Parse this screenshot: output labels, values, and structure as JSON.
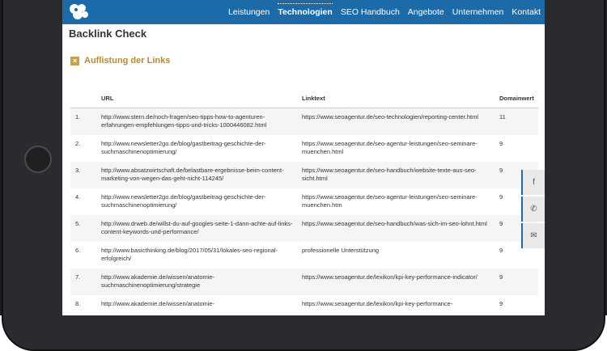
{
  "nav": {
    "items": [
      {
        "label": "Leistungen",
        "active": false
      },
      {
        "label": "Technologien",
        "active": true
      },
      {
        "label": "SEO Handbuch",
        "active": false
      },
      {
        "label": "Angebote",
        "active": false
      },
      {
        "label": "Unternehmen",
        "active": false
      },
      {
        "label": "Kontakt",
        "active": false
      }
    ]
  },
  "page": {
    "title": "Backlink Check",
    "accordion_label": "Auflistung der Links",
    "accordion_icon": "x-icon"
  },
  "table": {
    "headers": [
      "",
      "URL",
      "Linktext",
      "Domainwert"
    ],
    "rows": [
      {
        "num": "1.",
        "url": "http://www.stern.de/noch-fragen/seo-tipps-how-to-agenturen-erfahrungen-empfehlungen-tipps-und-tricks-1000446082.html",
        "linktext": "https://www.seoagentur.de/seo-technologien/reporting-center.html",
        "value": "11"
      },
      {
        "num": "2.",
        "url": "http://www.newsletter2go.de/blog/gastbeitrag-geschichte-der-suchmaschinenoptimierung/",
        "linktext": "https://www.seoagentur.de/seo-agentur-leistungen/seo-seminare-muenchen.html",
        "value": "9"
      },
      {
        "num": "3.",
        "url": "http://www.absatzwirtschaft.de/belastbare-ergebnisse-beim-content-marketing-von-wegen-das-geht-nicht-114245/",
        "linktext": "https://www.seoagentur.de/seo-handbuch/website-texte-aus-seo-sicht.html",
        "value": "9"
      },
      {
        "num": "4.",
        "url": "http://www.newsletter2go.de/blog/gastbeitrag-geschichte-der-suchmaschinenoptimierung/",
        "linktext": "https://www.seoagentur.de/seo-agentur-leistungen/seo-seminare-muenchen.htm",
        "value": "9"
      },
      {
        "num": "5.",
        "url": "http://www.drweb.de/willst-du-auf-googles-seite-1-dann-achte-auf-links-content-keywords-und-performance/",
        "linktext": "https://www.seoagentur.de/seo-handbuch/was-sich-im-seo-lohnt.html",
        "value": "9"
      },
      {
        "num": "6.",
        "url": "http://www.basicthinking.de/blog/2017/05/31/lokales-seo-regional-erfolgreich/",
        "linktext": "professionelle Unterstützung",
        "value": "9"
      },
      {
        "num": "7.",
        "url": "http://www.akademie.de/wissen/anatomie-suchmaschinenoptimierung/strategie",
        "linktext": "https://www.seoagentur.de/lexikon/kpi-key-performance-indicator/",
        "value": "9"
      },
      {
        "num": "8.",
        "url": "http://www.akademie.de/wissen/anatomie-",
        "linktext": "https://www.seoagentur.de/lexikon/kpi-key-performance-",
        "value": "9"
      }
    ]
  },
  "social": [
    {
      "icon": "facebook-icon",
      "glyph": "f"
    },
    {
      "icon": "phone-icon",
      "glyph": "✆"
    },
    {
      "icon": "mail-icon",
      "glyph": "✉"
    }
  ]
}
